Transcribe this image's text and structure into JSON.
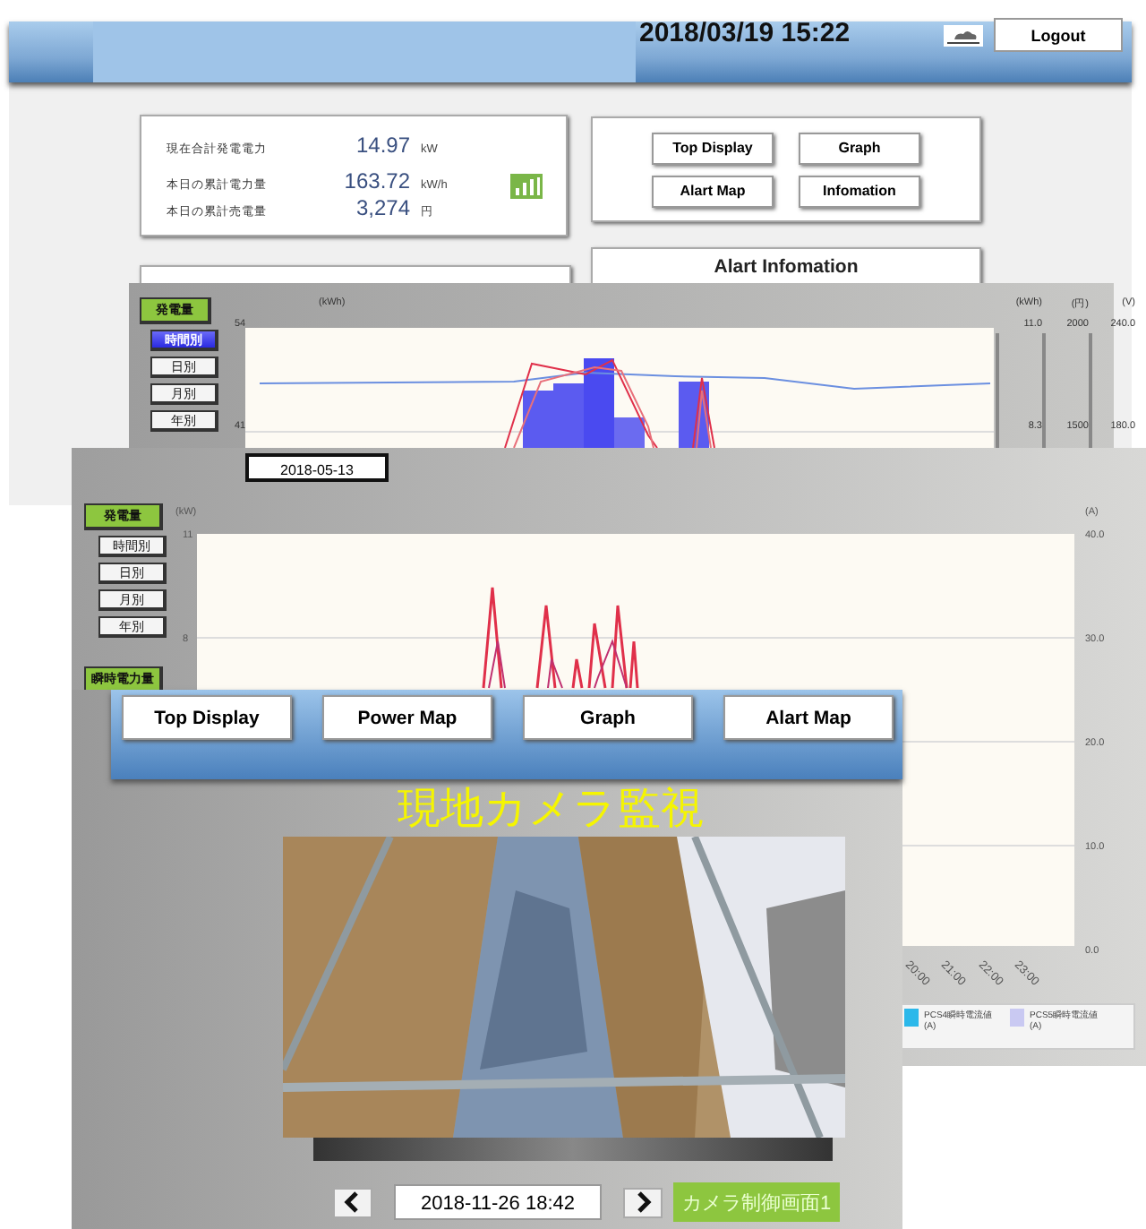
{
  "top_screen": {
    "header": {
      "datetime": "2018/03/19 15:22",
      "logout": "Logout"
    },
    "stats": [
      {
        "label": "現在合計発電電力",
        "value": "14.97",
        "unit": "kW"
      },
      {
        "label": "本日の累計電力量",
        "value": "163.72",
        "unit": "kW/h"
      },
      {
        "label": "本日の累計売電量",
        "value": "3,274",
        "unit": "円"
      }
    ],
    "nav": [
      "Top Display",
      "Graph",
      "Alart Map",
      "Infomation"
    ],
    "alert_panel": {
      "title": "Alart Infomation"
    }
  },
  "graph_screen_1": {
    "category": "発電量",
    "periods": [
      {
        "label": "時間別",
        "selected": true
      },
      {
        "label": "日別",
        "selected": false
      },
      {
        "label": "月別",
        "selected": false
      },
      {
        "label": "年別",
        "selected": false
      }
    ],
    "left_unit": "(kWh)",
    "left_ticks": [
      "54",
      "41"
    ],
    "right_units": [
      "(kWh)",
      "(円)",
      "(V)"
    ],
    "right_ticks": [
      [
        "11.0",
        "2000",
        "240.0"
      ],
      [
        "8.3",
        "1500",
        "180.0"
      ]
    ]
  },
  "graph_screen_2": {
    "date": "2018-05-13",
    "category": "発電量",
    "periods": [
      {
        "label": "時間別",
        "selected": false
      },
      {
        "label": "日別",
        "selected": false
      },
      {
        "label": "月別",
        "selected": false
      },
      {
        "label": "年別",
        "selected": false
      }
    ],
    "category_2": "瞬時電力量",
    "left_unit": "(kW)",
    "left_ticks": [
      "11",
      "8"
    ],
    "right_unit": "(A)",
    "right_ticks": [
      "40.0",
      "30.0",
      "20.0",
      "10.0",
      "0.0"
    ],
    "x_ticks": [
      "20:00",
      "21:00",
      "22:00",
      "23:00"
    ],
    "legend": [
      {
        "label": "PCS4瞬時電流値(A)",
        "color": "#2bb8ea"
      },
      {
        "label": "PCS5瞬時電流値(A)",
        "color": "#c9c9f2"
      }
    ]
  },
  "camera_screen": {
    "nav": [
      "Top Display",
      "Power Map",
      "Graph",
      "Alart Map"
    ],
    "title": "現地カメラ監視",
    "datetime": "2018-11-26 18:42",
    "control_button": "カメラ制御画面1"
  }
}
